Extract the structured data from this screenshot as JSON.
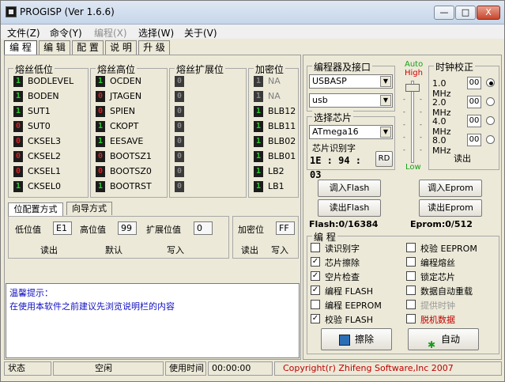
{
  "window": {
    "title": "PROGISP (Ver 1.6.6)",
    "min": "—",
    "max": "□",
    "close": "X"
  },
  "menu": [
    {
      "label": "文件(Z)",
      "disabled": false
    },
    {
      "label": "命令(Y)",
      "disabled": false
    },
    {
      "label": "编程(X)",
      "disabled": true
    },
    {
      "label": "选择(W)",
      "disabled": false
    },
    {
      "label": "关于(V)",
      "disabled": false
    }
  ],
  "tabs": [
    "编 程",
    "编 辑",
    "配 置",
    "说 明",
    "升 级"
  ],
  "fuse_low": {
    "title": "熔丝低位",
    "items": [
      {
        "bit": "1",
        "name": "BODLEVEL"
      },
      {
        "bit": "1",
        "name": "BODEN"
      },
      {
        "bit": "1",
        "name": "SUT1"
      },
      {
        "bit": "0",
        "name": "SUT0"
      },
      {
        "bit": "0",
        "name": "CKSEL3"
      },
      {
        "bit": "0",
        "name": "CKSEL2"
      },
      {
        "bit": "0",
        "name": "CKSEL1"
      },
      {
        "bit": "1",
        "name": "CKSEL0"
      }
    ]
  },
  "fuse_high": {
    "title": "熔丝高位",
    "items": [
      {
        "bit": "1",
        "name": "OCDEN"
      },
      {
        "bit": "0",
        "name": "JTAGEN"
      },
      {
        "bit": "0",
        "name": "SPIEN"
      },
      {
        "bit": "1",
        "name": "CKOPT"
      },
      {
        "bit": "1",
        "name": "EESAVE"
      },
      {
        "bit": "0",
        "name": "BOOTSZ1"
      },
      {
        "bit": "0",
        "name": "BOOTSZ0"
      },
      {
        "bit": "1",
        "name": "BOOTRST"
      }
    ]
  },
  "fuse_ext": {
    "title": "熔丝扩展位",
    "items": [
      {
        "bit": "0"
      },
      {
        "bit": "0"
      },
      {
        "bit": "0"
      },
      {
        "bit": "0"
      },
      {
        "bit": "0"
      },
      {
        "bit": "0"
      },
      {
        "bit": "0"
      },
      {
        "bit": "0"
      }
    ]
  },
  "lock": {
    "title": "加密位",
    "items": [
      {
        "bit": "1",
        "name": "NA",
        "dim": true
      },
      {
        "bit": "1",
        "name": "NA",
        "dim": true
      },
      {
        "bit": "1",
        "name": "BLB12"
      },
      {
        "bit": "1",
        "name": "BLB11"
      },
      {
        "bit": "1",
        "name": "BLB02"
      },
      {
        "bit": "1",
        "name": "BLB01"
      },
      {
        "bit": "1",
        "name": "LB2"
      },
      {
        "bit": "1",
        "name": "LB1"
      }
    ]
  },
  "subtabs": [
    "位配置方式",
    "向导方式"
  ],
  "config": {
    "low_label": "低位值",
    "low_value": "E1",
    "high_label": "高位值",
    "high_value": "99",
    "ext_label": "扩展位值",
    "ext_value": "0",
    "lock_label": "加密位",
    "lock_value": "FF",
    "read": "读出",
    "default": "默认",
    "write": "写入",
    "lock_read": "读出",
    "lock_write": "写入"
  },
  "tips": {
    "title": "温馨提示：",
    "text": "在使用本软件之前建议先浏览说明栏的内容"
  },
  "programmer": {
    "title": "编程器及接口",
    "device": "USBASP",
    "port": "usb"
  },
  "chip": {
    "title": "选择芯片",
    "name": "ATmega16",
    "id_title": "芯片识别字",
    "id_value": "1E : 94 : 03",
    "rd": "RD"
  },
  "speed": {
    "auto": "Auto",
    "high": "High",
    "low": "Low",
    "auto_color": "#1aa01a",
    "high_color": "#d00000",
    "low_color": "#1aa01a"
  },
  "clock": {
    "title": "时钟校正",
    "rows": [
      {
        "mhz": "1.0 MHz",
        "val": "00",
        "selected": true
      },
      {
        "mhz": "2.0 MHz",
        "val": "00",
        "selected": false
      },
      {
        "mhz": "4.0 MHz",
        "val": "00",
        "selected": false
      },
      {
        "mhz": "8.0 MHz",
        "val": "00",
        "selected": false
      }
    ],
    "read": "读出"
  },
  "buttons": {
    "load_flash": "调入Flash",
    "read_flash": "读出Flash",
    "load_eprom": "调入Eprom",
    "read_eprom": "读出Eprom"
  },
  "flash_info": "Flash:0/16384",
  "eprom_info": "Eprom:0/512",
  "program": {
    "title": "编 程",
    "left": [
      {
        "label": "读识别字",
        "checked": false
      },
      {
        "label": "芯片擦除",
        "checked": true
      },
      {
        "label": "空片检查",
        "checked": true
      },
      {
        "label": "编程 FLASH",
        "checked": true
      },
      {
        "label": "编程 EEPROM",
        "checked": false
      },
      {
        "label": "校验 FLASH",
        "checked": true
      }
    ],
    "right": [
      {
        "label": "校验 EEPROM",
        "checked": false
      },
      {
        "label": "编程熔丝",
        "checked": false
      },
      {
        "label": "锁定芯片",
        "checked": false
      },
      {
        "label": "数据自动重载",
        "checked": false
      },
      {
        "label": "提供时钟",
        "checked": false,
        "disabled": true
      },
      {
        "label": "脱机数据",
        "checked": false,
        "red": true
      }
    ],
    "erase": "擦除",
    "auto": "自动"
  },
  "status": {
    "state_label": "状态",
    "state": "空闲",
    "time_label": "使用时间",
    "time": "00:00:00",
    "copyright": "Copyright(r) Zhifeng Software,Inc 2007",
    "copyright_color": "#c00000"
  }
}
